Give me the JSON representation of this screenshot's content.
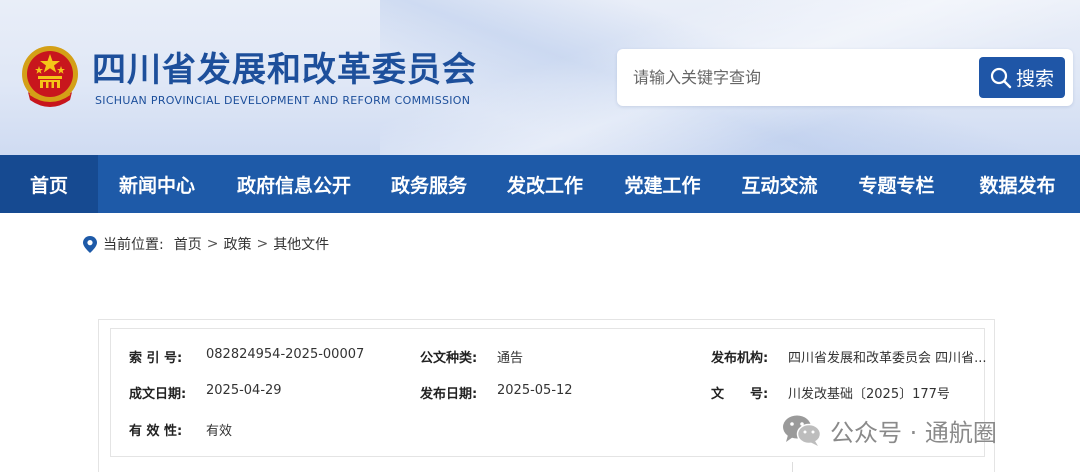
{
  "header": {
    "title": "四川省发展和改革委员会",
    "subtitle": "SICHUAN PROVINCIAL DEVELOPMENT AND REFORM COMMISSION",
    "emblem_icon": "national-emblem-icon"
  },
  "search": {
    "placeholder": "请输入关键字查询",
    "button_label": "搜索"
  },
  "nav": {
    "items": [
      "首页",
      "新闻中心",
      "政府信息公开",
      "政务服务",
      "发改工作",
      "党建工作",
      "互动交流",
      "专题专栏",
      "数据发布"
    ],
    "active_index": 0
  },
  "breadcrumb": {
    "label": "当前位置:",
    "items": [
      "首页",
      "政策",
      "其他文件"
    ],
    "separator": ">"
  },
  "info": {
    "index_no_label": "索 引 号:",
    "index_no": "082824954-2025-00007",
    "doc_type_label": "公文种类:",
    "doc_type": "通告",
    "issuer_label": "发布机构:",
    "issuer": "四川省发展和改革委员会 四川省...",
    "written_date_label": "成文日期:",
    "written_date": "2025-04-29",
    "publish_date_label": "发布日期:",
    "publish_date": "2025-05-12",
    "doc_no_label": "文　　号:",
    "doc_no": "川发改基础〔2025〕177号",
    "validity_label": "有 效 性:",
    "validity": "有效"
  },
  "watermark": {
    "text": "公众号 · 通航圈"
  },
  "colors": {
    "brand_blue": "#1e5aa8",
    "nav_active": "#164a91",
    "title_blue": "#1d4f9b"
  }
}
